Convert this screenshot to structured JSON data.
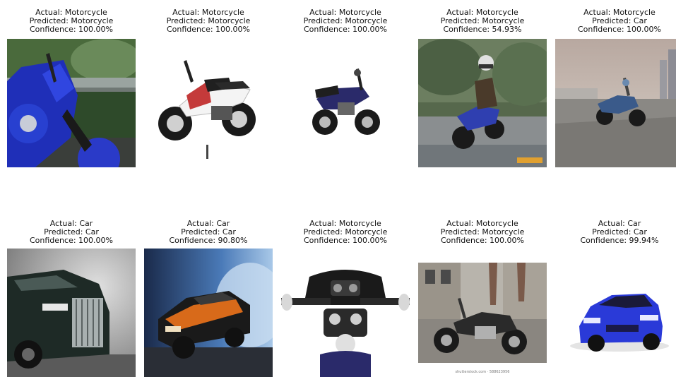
{
  "grid": [
    {
      "actual": "Actual: Motorcycle",
      "predicted": "Predicted: Motorcycle",
      "confidence": "Confidence: 100.00%"
    },
    {
      "actual": "Actual: Motorcycle",
      "predicted": "Predicted: Motorcycle",
      "confidence": "Confidence: 100.00%"
    },
    {
      "actual": "Actual: Motorcycle",
      "predicted": "Predicted: Motorcycle",
      "confidence": "Confidence: 100.00%"
    },
    {
      "actual": "Actual: Motorcycle",
      "predicted": "Predicted: Motorcycle",
      "confidence": "Confidence: 54.93%"
    },
    {
      "actual": "Actual: Motorcycle",
      "predicted": "Predicted: Car",
      "confidence": "Confidence: 100.00%"
    },
    {
      "actual": "Actual: Car",
      "predicted": "Predicted: Car",
      "confidence": "Confidence: 100.00%"
    },
    {
      "actual": "Actual: Car",
      "predicted": "Predicted: Car",
      "confidence": "Confidence: 90.80%"
    },
    {
      "actual": "Actual: Motorcycle",
      "predicted": "Predicted: Motorcycle",
      "confidence": "Confidence: 100.00%"
    },
    {
      "actual": "Actual: Motorcycle",
      "predicted": "Predicted: Motorcycle",
      "confidence": "Confidence: 100.00%"
    },
    {
      "actual": "Actual: Car",
      "predicted": "Predicted: Car",
      "confidence": "Confidence: 99.94%"
    }
  ],
  "watermark": "shutterstock.com · 588623956"
}
